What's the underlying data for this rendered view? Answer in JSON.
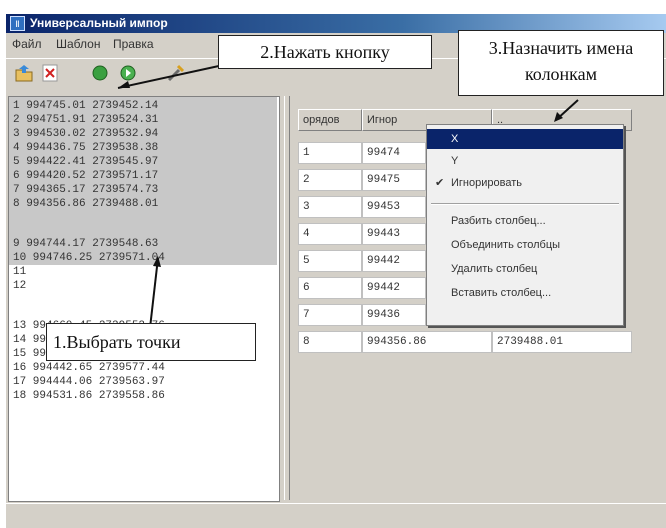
{
  "window": {
    "title": "Универсальный импор"
  },
  "menu": [
    "Файл",
    "Шаблон",
    "Правка"
  ],
  "toolbar": {
    "icons": [
      "open-folder-icon",
      "delete-icon",
      "prev-icon",
      "next-icon",
      "tools-icon"
    ]
  },
  "source_lines": {
    "group1": [
      "1 994745.01 2739452.14",
      "2 994751.91 2739524.31",
      "3 994530.02 2739532.94",
      "4 994436.75 2739538.38",
      "5 994422.41 2739545.97",
      "6 994420.52 2739571.17",
      "7 994365.17 2739574.73",
      "8 994356.86 2739488.01"
    ],
    "group2": [
      "9 994744.17 2739548.63",
      "10 994746.25 2739571.04",
      "11",
      "12"
    ],
    "group3": [
      "13 994660.45 2739552.76",
      "14 994661.59 2739567.76",
      "15 994486.62 2739576.43",
      "16 994442.65 2739577.44",
      "17 994444.06 2739563.97",
      "18 994531.86 2739558.86"
    ]
  },
  "grid": {
    "headers": [
      "орядов",
      "Игнор",
      ".."
    ],
    "col1": [
      "1",
      "2",
      "3",
      "4",
      "5",
      "6",
      "7",
      "8"
    ],
    "col2": [
      "99474",
      "99475",
      "99453",
      "99443",
      "99442",
      "99442",
      "99436",
      "994356.86"
    ],
    "last_row_col3": "2739488.01"
  },
  "context_menu": {
    "items": [
      "X",
      "Y",
      "Игнорировать",
      "Разбить столбец...",
      "Объединить столбцы",
      "Удалить столбец",
      "Вставить столбец..."
    ],
    "checked": "Игнорировать",
    "selected": "X"
  },
  "callouts": {
    "step1": "1.Выбрать точки",
    "step2": "2.Нажать кнопку",
    "step3_line1": "3.Назначить имена",
    "step3_line2": "колонкам"
  }
}
